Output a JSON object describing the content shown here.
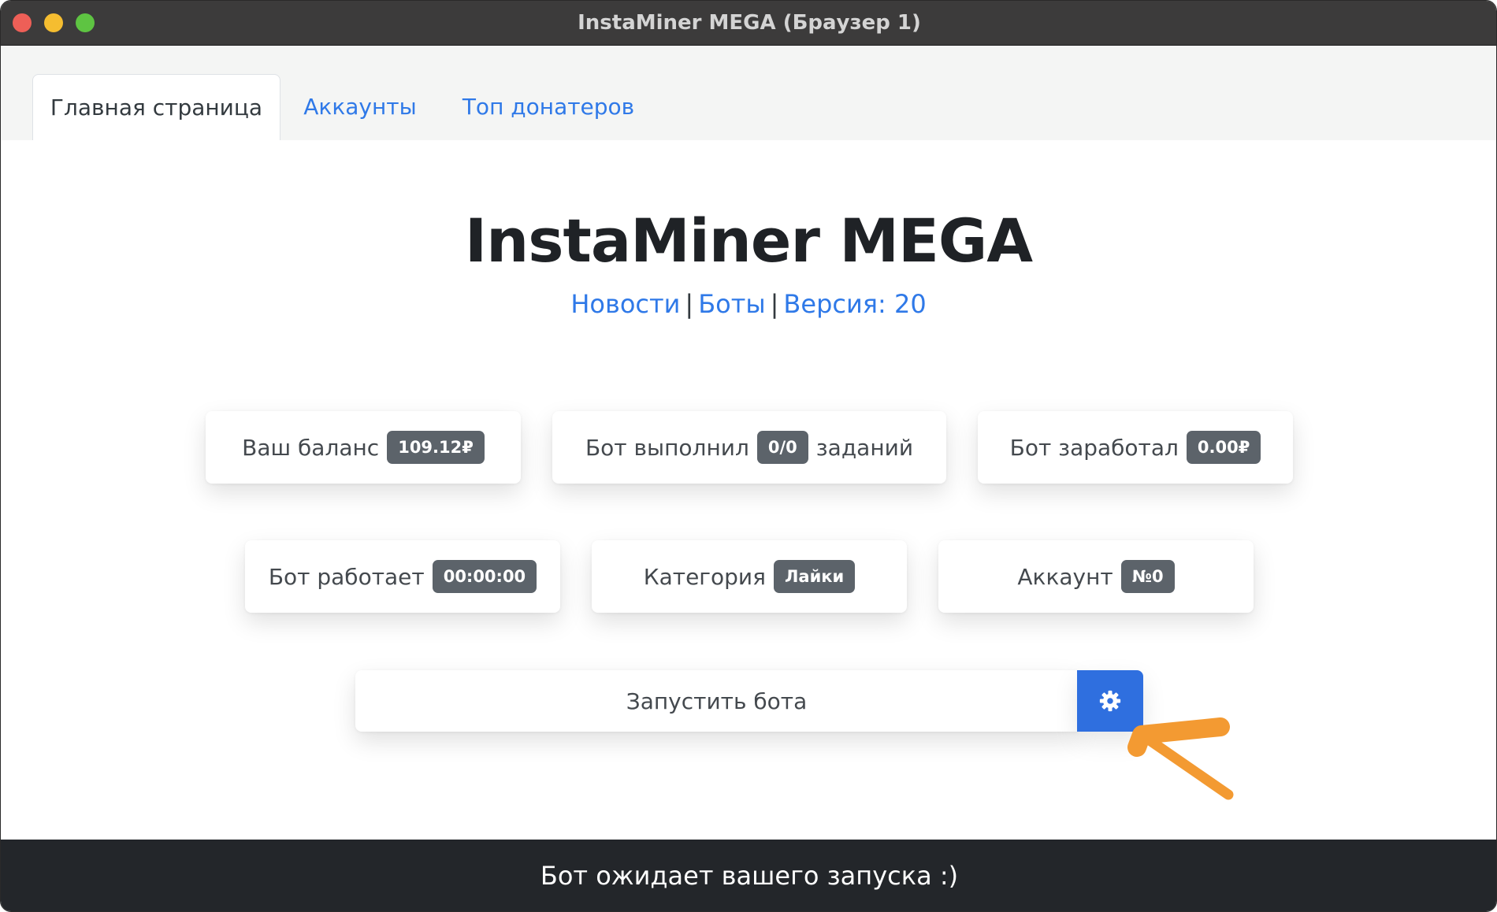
{
  "window": {
    "title": "InstaMiner MEGA (Браузер 1)"
  },
  "tabs": [
    {
      "label": "Главная страница",
      "active": true
    },
    {
      "label": "Аккаунты",
      "active": false
    },
    {
      "label": "Топ донатеров",
      "active": false
    }
  ],
  "header": {
    "title": "InstaMiner MEGA",
    "links": {
      "news": "Новости",
      "bots": "Боты",
      "version": "Версия: 20",
      "separator": "|"
    }
  },
  "stats": {
    "balance": {
      "label": "Ваш баланс",
      "value": "109.12₽"
    },
    "tasks": {
      "label_before": "Бот выполнил",
      "value": "0/0",
      "label_after": "заданий"
    },
    "earned": {
      "label": "Бот заработал",
      "value": "0.00₽"
    },
    "uptime": {
      "label": "Бот работает",
      "value": "00:00:00"
    },
    "category": {
      "label": "Категория",
      "value": "Лайки"
    },
    "account": {
      "label": "Аккаунт",
      "value": "№0"
    }
  },
  "controls": {
    "launch_label": "Запустить бота",
    "settings_icon": "gear-icon"
  },
  "annotation": {
    "arrow_color": "#f39a32"
  },
  "status": {
    "message": "Бот ожидает вашего запуска :)"
  },
  "colors": {
    "accent": "#2f79e8",
    "badge": "#5c636a",
    "status_bar": "#23262a",
    "titlebar": "#3c3b3b"
  }
}
